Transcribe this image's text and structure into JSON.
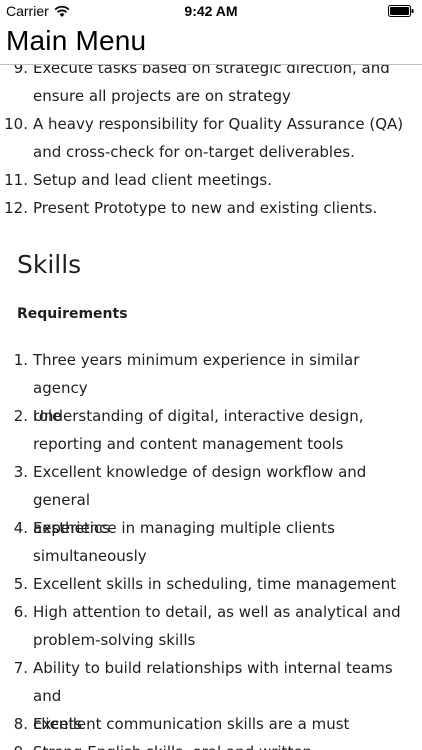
{
  "status_bar": {
    "carrier": "Carrier",
    "time": "9:42 AM"
  },
  "nav": {
    "title": "Main Menu"
  },
  "previous_list": [
    {
      "num": "9.",
      "lines": [
        "Execute tasks based on strategic direction, and",
        "ensure all projects are on strategy"
      ]
    },
    {
      "num": "10.",
      "lines": [
        "A heavy responsibility for Quality Assurance (QA)",
        "and cross-check for on-target deliverables."
      ]
    },
    {
      "num": "11.",
      "lines": [
        "Setup and lead client meetings."
      ]
    },
    {
      "num": "12.",
      "lines": [
        "Present Prototype to new and existing clients."
      ]
    }
  ],
  "skills": {
    "title": "Skills",
    "subtitle": "Requirements",
    "items": [
      {
        "num": "1.",
        "lines": [
          "Three years minimum experience in similar agency",
          "role"
        ]
      },
      {
        "num": "2.",
        "lines": [
          "Understanding of digital, interactive design,",
          "reporting and content management tools"
        ]
      },
      {
        "num": "3.",
        "lines": [
          "Excellent knowledge of design workflow and general",
          "aesthetics"
        ]
      },
      {
        "num": "4.",
        "lines": [
          "Experience in managing multiple clients",
          "simultaneously"
        ]
      },
      {
        "num": "5.",
        "lines": [
          "Excellent skills in scheduling, time management"
        ]
      },
      {
        "num": "6.",
        "lines": [
          "High attention to detail, as well as analytical and",
          "problem-solving skills"
        ]
      },
      {
        "num": "7.",
        "lines": [
          "Ability to build relationships with internal teams and",
          "clients"
        ]
      },
      {
        "num": "8.",
        "lines": [
          "Excellent communication skills are a must"
        ]
      },
      {
        "num": "9.",
        "lines": [
          "Strong English skills, oral and written"
        ]
      }
    ]
  }
}
